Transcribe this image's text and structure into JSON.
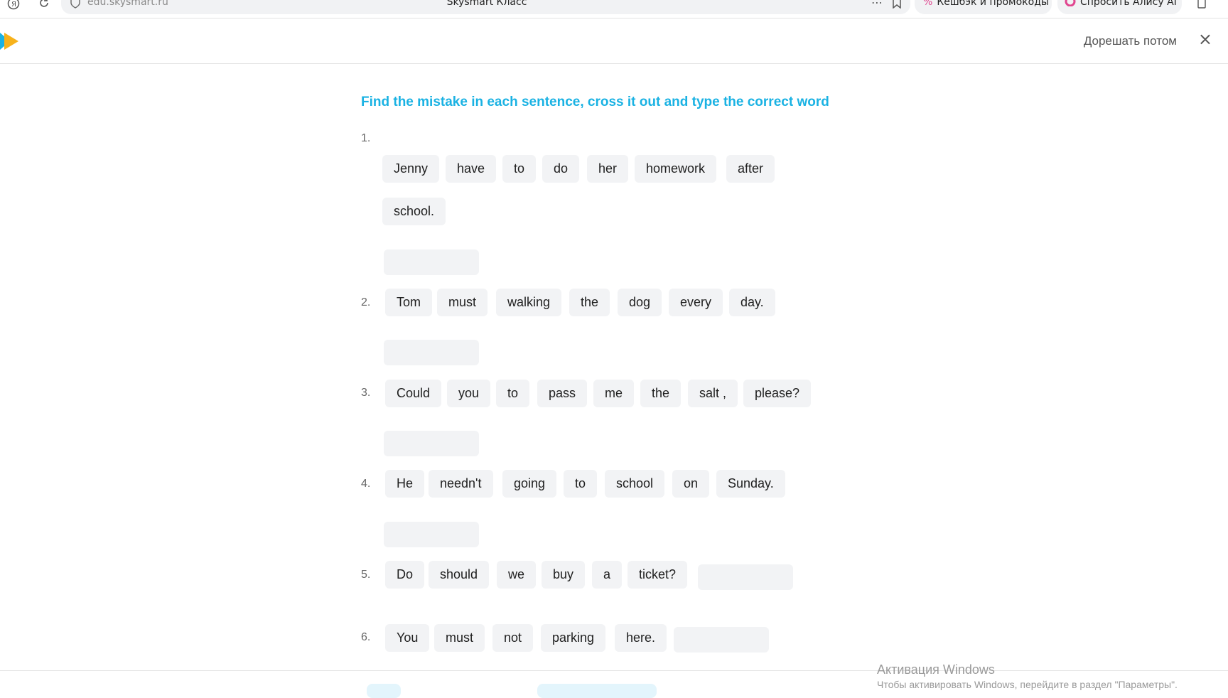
{
  "browser": {
    "address": "edu.skysmart.ru",
    "tab_title": "Skysmart Класс",
    "more_icon": "⋯",
    "cashback_label": "Кешбэк и промокоды",
    "alice_label": "Спросить Алису AI",
    "icons": [
      "yandex-icon",
      "reload-icon",
      "shield-icon",
      "more-icon",
      "bookmark-icon",
      "percent-icon",
      "alice-icon",
      "clipboard-icon"
    ]
  },
  "header": {
    "later_label": "Дорешать потом",
    "close_icon": "×",
    "logo_colors": [
      "#1ab2e3",
      "#f7b21b"
    ]
  },
  "task": {
    "title": "Find the mistake in each sentence, cross it out and type the correct word",
    "items": [
      {
        "number": "1.",
        "words": [
          "Jenny",
          "have",
          "to",
          "do",
          "her",
          "homework",
          "after",
          "school."
        ]
      },
      {
        "number": "2.",
        "words": [
          "Tom",
          "must",
          "walking",
          "the",
          "dog",
          "every",
          "day."
        ]
      },
      {
        "number": "3.",
        "words": [
          "Could",
          "you",
          "to",
          "pass",
          "me",
          "the",
          "salt ,",
          "please?"
        ]
      },
      {
        "number": "4.",
        "words": [
          "He",
          "needn't",
          "going",
          "to",
          "school",
          "on",
          "Sunday."
        ]
      },
      {
        "number": "5.",
        "words": [
          "Do",
          "should",
          "we",
          "buy",
          "a",
          "ticket?"
        ]
      },
      {
        "number": "6.",
        "words": [
          "You",
          "must",
          "not",
          "parking",
          "here."
        ]
      }
    ],
    "answer_value": ""
  },
  "watermark": {
    "line1": "Активация Windows",
    "line2": "Чтобы активировать Windows, перейдите в раздел \"Параметры\"."
  },
  "colors": {
    "accent": "#1ab2e3",
    "chip_bg": "#f2f3f5"
  }
}
